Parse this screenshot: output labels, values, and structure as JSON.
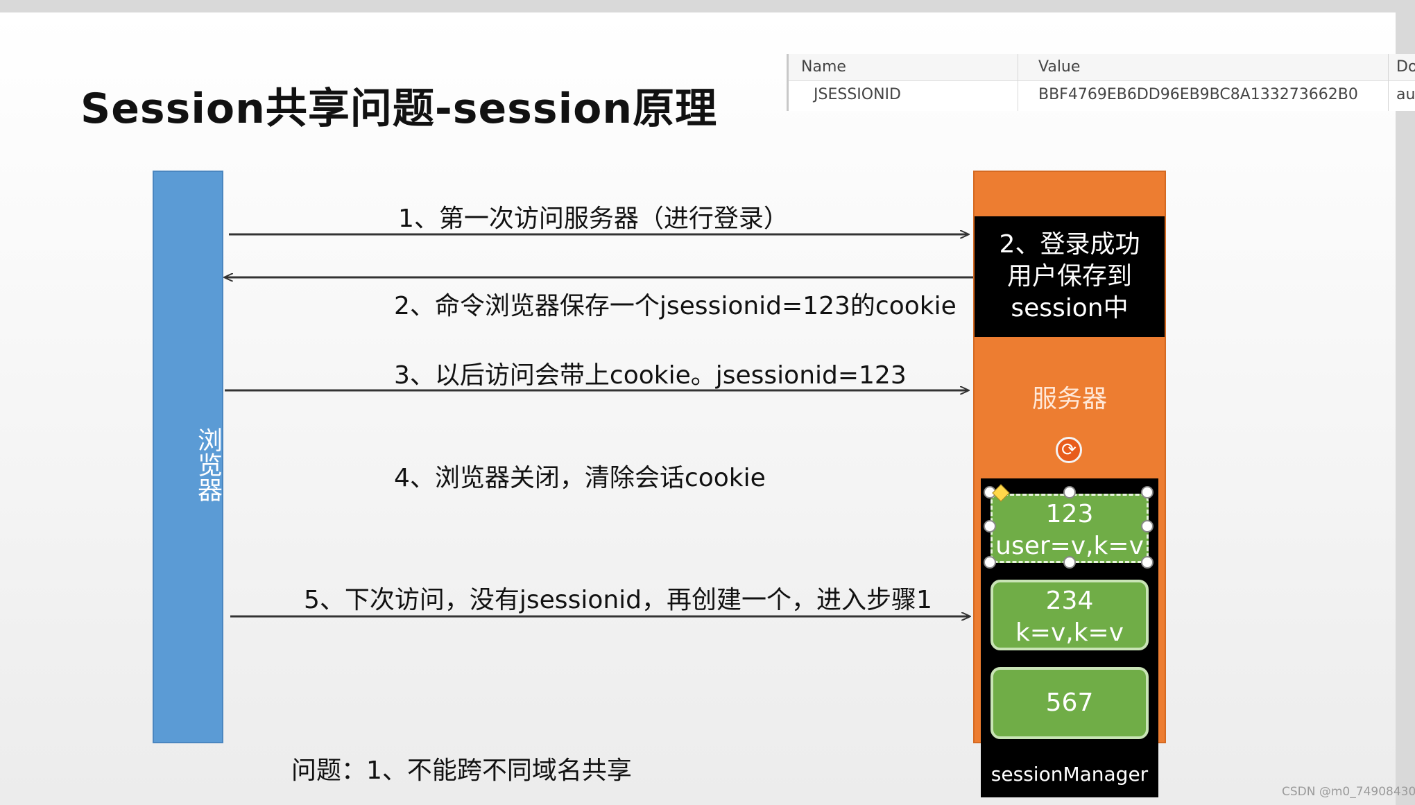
{
  "title": "Session共享问题-session原理",
  "cookie_table": {
    "columns": [
      "Name",
      "Value",
      "Do"
    ],
    "row": [
      "JSESSIONID",
      "BBF4769EB6DD96EB9BC8A133273662B0",
      "aut"
    ]
  },
  "browser": {
    "label": "浏览器"
  },
  "server": {
    "label": "服务器",
    "login_lines": [
      "2、登录成功",
      "用户保存到",
      "session中"
    ],
    "session_manager_label": "sessionManager",
    "sessions": [
      {
        "lines": [
          "123",
          "user=v,k=v"
        ]
      },
      {
        "lines": [
          "234",
          "k=v,k=v"
        ]
      },
      {
        "lines": [
          "567"
        ]
      }
    ]
  },
  "messages": [
    {
      "text": "1、第一次访问服务器（进行登录）",
      "direction": "to-server"
    },
    {
      "text": "2、命令浏览器保存一个jsessionid=123的cookie",
      "direction": "to-browser"
    },
    {
      "text": "3、以后访问会带上cookie。jsessionid=123",
      "direction": "to-server"
    },
    {
      "text": "4、浏览器关闭，清除会话cookie",
      "direction": "none"
    },
    {
      "text": "5、下次访问，没有jsessionid，再创建一个，进入步骤1",
      "direction": "to-server"
    }
  ],
  "problem": "问题：1、不能跨不同域名共享",
  "watermark": "CSDN @m0_74908430",
  "colors": {
    "browser": "#5b9bd5",
    "server": "#ed7d31",
    "session": "#70ad47"
  }
}
